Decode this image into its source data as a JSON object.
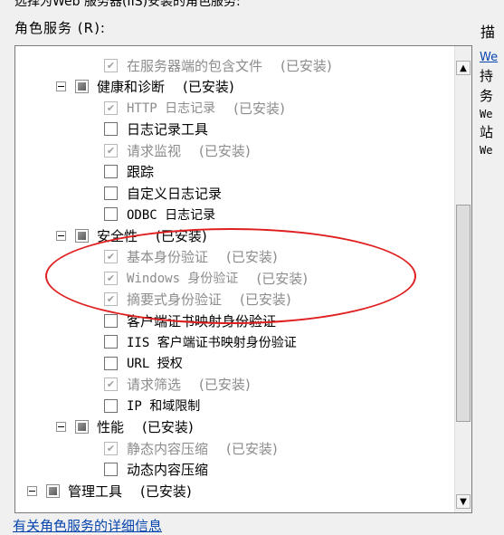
{
  "window": {
    "top_partial_text": "选择为Web 服务器(IIS)安装的角色服务:",
    "roles_label": "角色服务",
    "roles_shortcut": "(R):"
  },
  "tree": [
    {
      "kind": "item",
      "label": "在服务器端的包含文件",
      "status": "(已安装)",
      "checked": true,
      "disabled": true
    },
    {
      "kind": "group",
      "label": "健康和诊断",
      "status": "(已安装)"
    },
    {
      "kind": "item",
      "label": "HTTP 日志记录",
      "status": "(已安装)",
      "checked": true,
      "disabled": true
    },
    {
      "kind": "item",
      "label": "日志记录工具",
      "status": "",
      "checked": false,
      "disabled": false
    },
    {
      "kind": "item",
      "label": "请求监视",
      "status": "(已安装)",
      "checked": true,
      "disabled": true
    },
    {
      "kind": "item",
      "label": "跟踪",
      "status": "",
      "checked": false,
      "disabled": false
    },
    {
      "kind": "item",
      "label": "自定义日志记录",
      "status": "",
      "checked": false,
      "disabled": false
    },
    {
      "kind": "item",
      "label": "ODBC 日志记录",
      "status": "",
      "checked": false,
      "disabled": false
    },
    {
      "kind": "group",
      "label": "安全性",
      "status": "(已安装)"
    },
    {
      "kind": "item",
      "label": "基本身份验证",
      "status": "(已安装)",
      "checked": true,
      "disabled": true
    },
    {
      "kind": "item",
      "label": "Windows 身份验证",
      "status": "(已安装)",
      "checked": true,
      "disabled": true
    },
    {
      "kind": "item",
      "label": "摘要式身份验证",
      "status": "(已安装)",
      "checked": true,
      "disabled": true
    },
    {
      "kind": "item",
      "label": "客户端证书映射身份验证",
      "status": "",
      "checked": false,
      "disabled": false
    },
    {
      "kind": "item",
      "label": "IIS 客户端证书映射身份验证",
      "status": "",
      "checked": false,
      "disabled": false
    },
    {
      "kind": "item",
      "label": "URL 授权",
      "status": "",
      "checked": false,
      "disabled": false
    },
    {
      "kind": "item",
      "label": "请求筛选",
      "status": "(已安装)",
      "checked": true,
      "disabled": true
    },
    {
      "kind": "item",
      "label": "IP 和域限制",
      "status": "",
      "checked": false,
      "disabled": false
    },
    {
      "kind": "group",
      "label": "性能",
      "status": "(已安装)"
    },
    {
      "kind": "item",
      "label": "静态内容压缩",
      "status": "(已安装)",
      "checked": true,
      "disabled": true
    },
    {
      "kind": "item",
      "label": "动态内容压缩",
      "status": "",
      "checked": false,
      "disabled": false
    },
    {
      "kind": "toplevel",
      "label": "管理工具",
      "status": "(已安装)"
    }
  ],
  "description": {
    "heading": "描",
    "link_text": "We",
    "lines": [
      "持",
      "务",
      "We",
      "站",
      "We"
    ]
  },
  "bottom_link": "有关角色服务的详细信息",
  "annotation_color": "#e02020",
  "link_color": "#0645ad"
}
